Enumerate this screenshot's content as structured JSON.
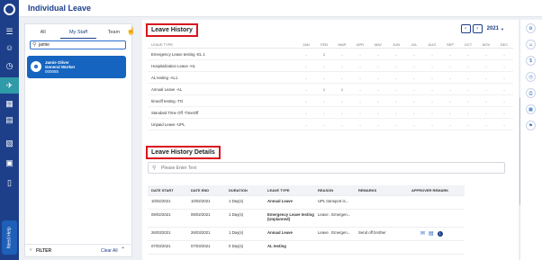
{
  "header": {
    "title": "Individual Leave"
  },
  "staff_panel": {
    "tabs": [
      {
        "label": "All"
      },
      {
        "label": "My Staff"
      },
      {
        "label": "Team"
      }
    ],
    "search_value": "jamie",
    "staff": {
      "name": "Jamie Oliver",
      "role": "General Worker",
      "code": "000085"
    },
    "filter_label": "FILTER",
    "clear_label": "Clear All"
  },
  "leave_history": {
    "title": "Leave History",
    "year": "2021",
    "header_type": "LEAVE TYPE",
    "months": [
      "JAN",
      "FEB",
      "MAR",
      "APR",
      "MAY",
      "JUN",
      "JUL",
      "AUG",
      "SEP",
      "OCT",
      "NOV",
      "DEC"
    ],
    "rows": [
      {
        "type": "Emergency Leave testing -EL 1",
        "values": [
          "-",
          "1",
          "-",
          "-",
          "-",
          "-",
          "-",
          "-",
          "-",
          "-",
          "-",
          "-"
        ]
      },
      {
        "type": "Hospitalization Leave -HL",
        "values": [
          "-",
          "-",
          "-",
          "-",
          "-",
          "-",
          "-",
          "-",
          "-",
          "-",
          "-",
          "-"
        ]
      },
      {
        "type": "AL testing -AL1",
        "values": [
          "-",
          "-",
          "-",
          "-",
          "-",
          "-",
          "-",
          "-",
          "-",
          "-",
          "-",
          "-"
        ]
      },
      {
        "type": "Annual Leave -AL",
        "values": [
          "-",
          "1",
          "1",
          "-",
          "-",
          "-",
          "-",
          "-",
          "-",
          "-",
          "-",
          "-"
        ]
      },
      {
        "type": "timeoff testing -TO",
        "values": [
          "-",
          "-",
          "-",
          "-",
          "-",
          "-",
          "-",
          "-",
          "-",
          "-",
          "-",
          "-"
        ]
      },
      {
        "type": "Standard Time Off -TimeOff",
        "values": [
          "-",
          "-",
          "-",
          "-",
          "-",
          "-",
          "-",
          "-",
          "-",
          "-",
          "-",
          "-"
        ]
      },
      {
        "type": "Unpaid Leave -UPL",
        "values": [
          "-",
          "-",
          "-",
          "-",
          "-",
          "-",
          "-",
          "-",
          "-",
          "-",
          "-",
          "-"
        ]
      }
    ]
  },
  "leave_history_details": {
    "title": "Leave History Details",
    "search_placeholder": "Please Enter Text",
    "headers": {
      "date_start": "DATE START",
      "date_end": "DATE END",
      "duration": "DURATION",
      "leave_type": "LEAVE TYPE",
      "reason": "REASON",
      "remarks": "REMARKS",
      "approver_remark": "APPROVER REMARK"
    },
    "rows": [
      {
        "date_start": "10/02/2021",
        "date_end": "10/02/2021",
        "duration": "1 Day(s)",
        "leave_type": "Annual Leave",
        "reason": "UPL transport is...",
        "remarks": ""
      },
      {
        "date_start": "09/02/2021",
        "date_end": "09/02/2021",
        "duration": "1 Day(s)",
        "leave_type": "Emergency Leave testing (Unplanned)",
        "reason": "Leave . Emergen...",
        "remarks": ""
      },
      {
        "date_start": "26/03/2021",
        "date_end": "26/03/2021",
        "duration": "1 Day(s)",
        "leave_type": "Annual Leave",
        "reason": "Leave . Emergen...",
        "remarks": "Send off brother",
        "badge": "1"
      },
      {
        "date_start": "07/03/2021",
        "date_end": "07/03/2021",
        "duration": "0 Day(s)",
        "leave_type": "AL testing",
        "reason": "",
        "remarks": ""
      }
    ]
  },
  "rail": {
    "help_label": "Need Help"
  }
}
